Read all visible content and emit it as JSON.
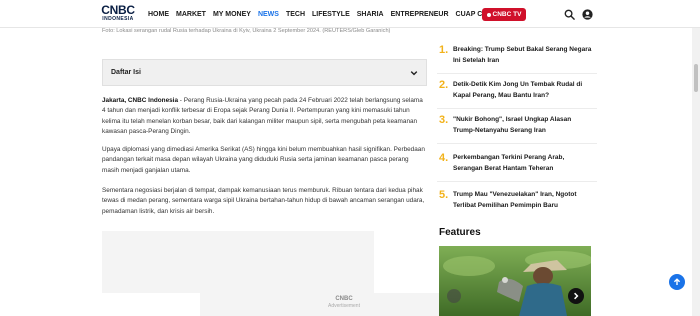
{
  "header": {
    "logo_main": "CNBC",
    "logo_sub": "INDONESIA",
    "nav": [
      "HOME",
      "MARKET",
      "MY MONEY",
      "NEWS",
      "TECH",
      "LIFESTYLE",
      "SHARIA",
      "ENTREPRENEUR",
      "CUAP CUAP CUAN"
    ],
    "active_nav": "NEWS",
    "cnbc_tv_label": "CNBC TV",
    "accent_color": "#1a73e8",
    "tv_color": "#d0102a"
  },
  "article": {
    "caption": "Foto: Lokasi serangan rudal Rusia terhadap Ukraina di Kyiv, Ukraina 2 September 2024. (REUTERS/Gleb Garanich)",
    "toc_label": "Daftar Isi",
    "p1_lead": "Jakarta, CNBC Indonesia",
    "p1_body": " - Perang Rusia-Ukraina yang pecah pada 24 Februari 2022 telah berlangsung selama 4 tahun dan menjadi konflik terbesar di Eropa sejak Perang Dunia II. Pertempuran yang kini memasuki tahun kelima itu telah menelan korban besar, baik dari kalangan militer maupun sipil, serta mengubah peta keamanan kawasan pasca-Perang Dingin.",
    "p2": "Upaya diplomasi yang dimediasi Amerika Serikat (AS) hingga kini belum membuahkan hasil signifikan. Perbedaan pandangan terkait masa depan wilayah Ukraina yang diduduki Rusia serta jaminan keamanan pasca perang masih menjadi ganjalan utama.",
    "p3": "Sementara negosiasi berjalan di tempat, dampak kemanusiaan terus memburuk. Ribuan tentara dari kedua pihak tewas di medan perang, sementara warga sipil Ukraina bertahan-tahun hidup di bawah ancaman serangan udara, pemadaman listrik, dan krisis air bersih.",
    "ad_logo": "CNBC",
    "ad_label": "Advertisement"
  },
  "sidebar": {
    "trending": [
      {
        "num": "1.",
        "title": "Breaking: Trump Sebut Bakal Serang Negara Ini Setelah Iran"
      },
      {
        "num": "2.",
        "title": "Detik-Detik Kim Jong Un Tembak Rudal di Kapal Perang, Mau Bantu Iran?"
      },
      {
        "num": "3.",
        "title": "\"Nukir Bohong\", Israel Ungkap Alasan Trump-Netanyahu Serang Iran"
      },
      {
        "num": "4.",
        "title": "Perkembangan Terkini Perang Arab, Serangan Berat Hantam Teheran"
      },
      {
        "num": "5.",
        "title": "Trump Mau \"Venezuelakan\" Iran, Ngotot Terlibat Pemilihan Pemimpin Baru"
      }
    ],
    "number_color": "#f2b21a",
    "features_title": "Features"
  }
}
